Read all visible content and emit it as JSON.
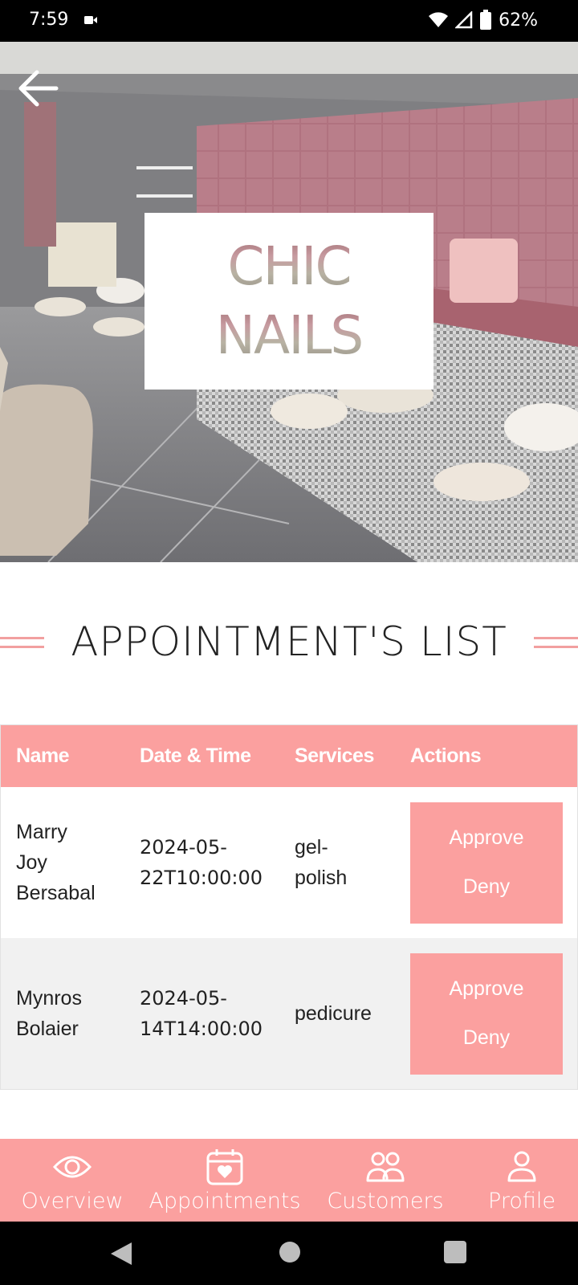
{
  "status_bar": {
    "time": "7:59",
    "battery": "62%",
    "icons": [
      "video-record-icon",
      "wifi-icon",
      "cell-signal-icon",
      "battery-icon"
    ]
  },
  "hero": {
    "logo_line1": "CHIC",
    "logo_line2": "NAILS",
    "back_icon": "arrow-left-icon"
  },
  "page_title": "APPOINTMENT'S LIST",
  "table": {
    "headers": [
      "Name",
      "Date & Time",
      "Services",
      "Actions"
    ],
    "rows": [
      {
        "name_lines": [
          "Marry",
          "Joy",
          "Bersabal"
        ],
        "date_lines": [
          "2024-05-",
          "22T10:00:00"
        ],
        "service_lines": [
          "gel-",
          "polish"
        ],
        "approve": "Approve",
        "deny": "Deny"
      },
      {
        "name_lines": [
          "Mynros",
          "Bolaier"
        ],
        "date_lines": [
          "2024-05-",
          "14T14:00:00"
        ],
        "service_lines": [
          "pedicure"
        ],
        "approve": "Approve",
        "deny": "Deny"
      }
    ]
  },
  "bottom_nav": {
    "items": [
      {
        "label": "Overview",
        "icon": "eye-icon"
      },
      {
        "label": "Appointments",
        "icon": "calendar-heart-icon"
      },
      {
        "label": "Customers",
        "icon": "users-icon"
      },
      {
        "label": "Profile",
        "icon": "user-icon"
      }
    ]
  },
  "colors": {
    "accent": "#fba09f",
    "status_bar": "#000000",
    "alt_row": "#f1f1f1"
  }
}
